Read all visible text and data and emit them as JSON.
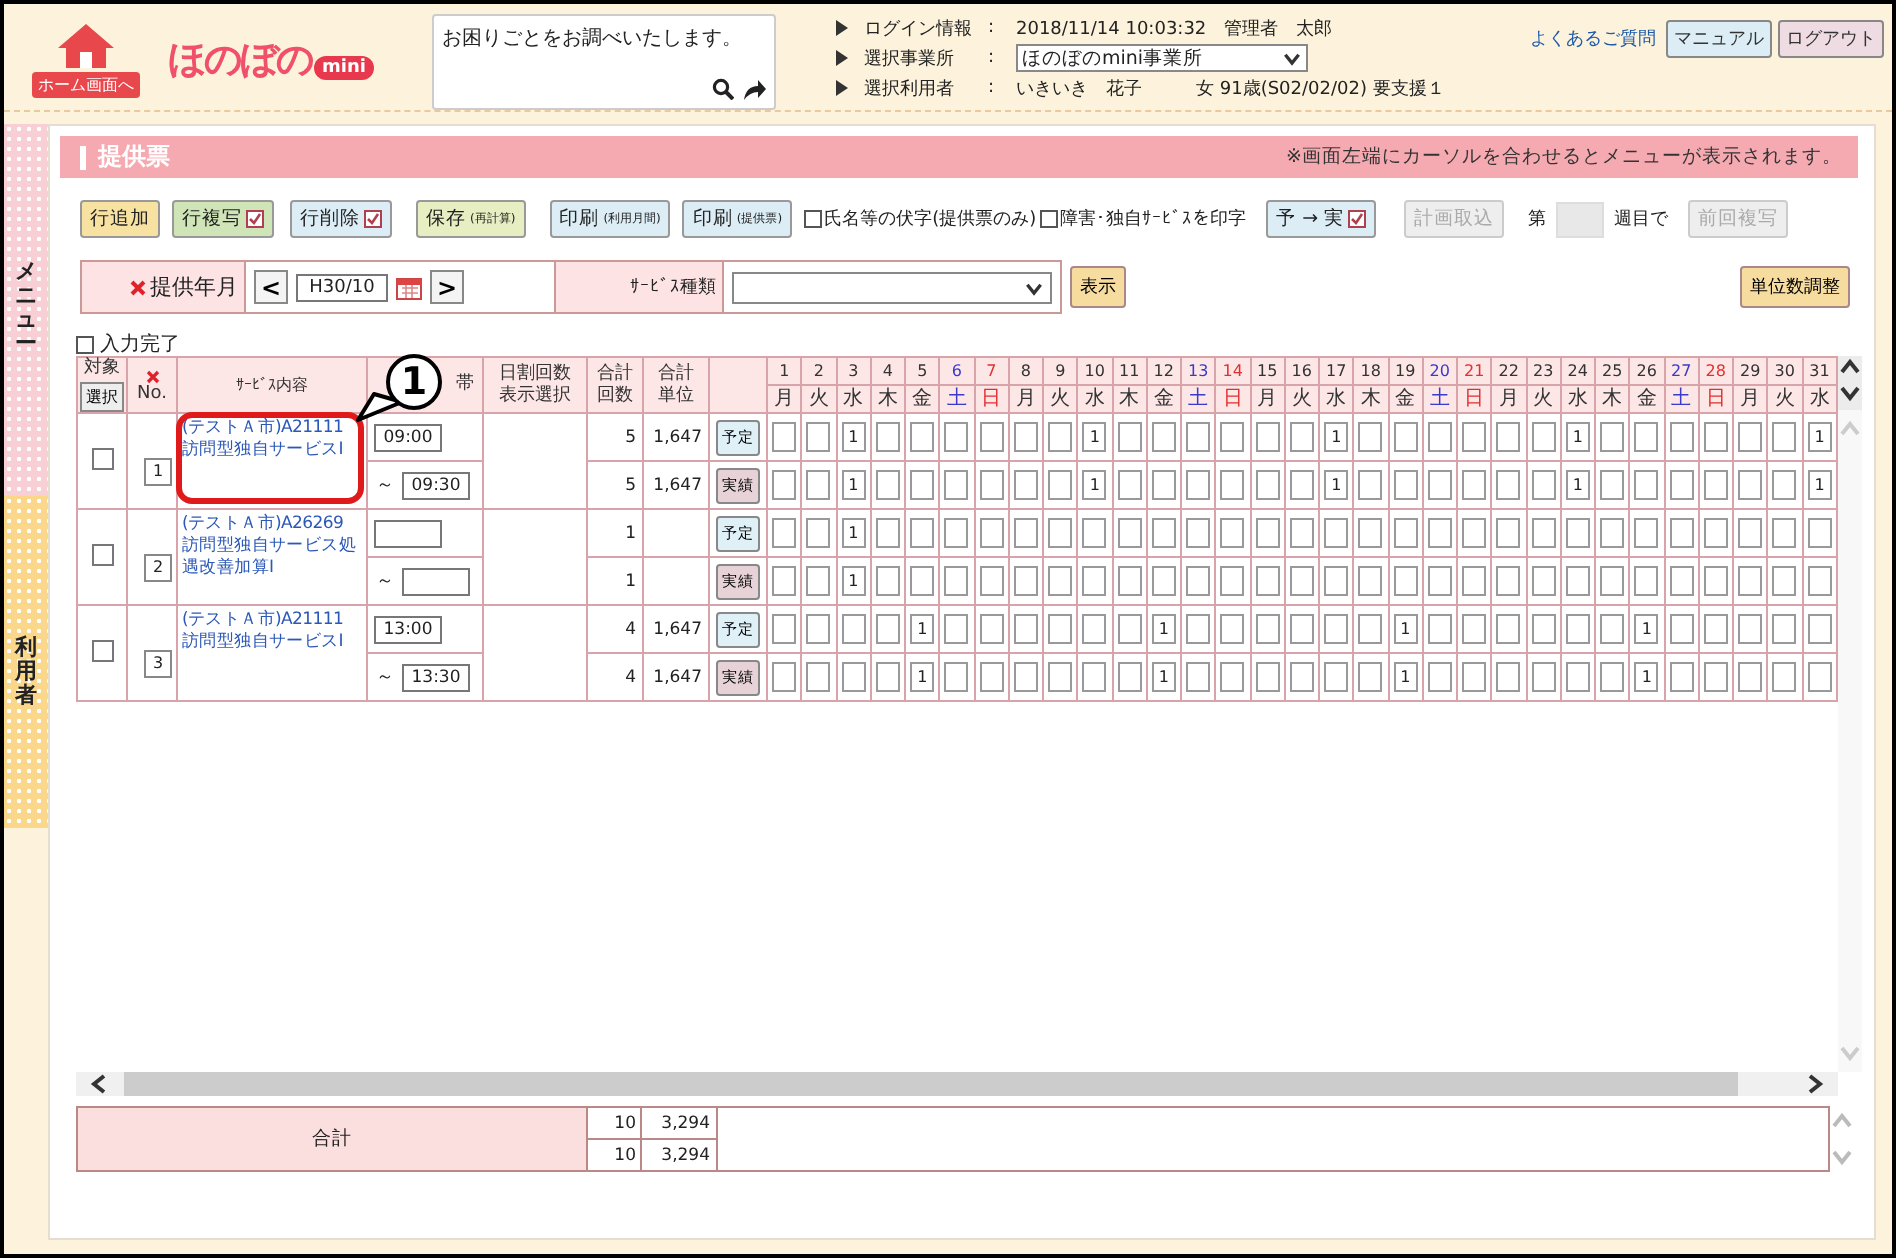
{
  "header": {
    "home": "ホーム画面へ",
    "brand": "ほのぼの",
    "brand_badge": "mini",
    "search": {
      "placeholder": "お困りごとをお調べいたします。"
    },
    "info": [
      {
        "label": "ログイン情報",
        "sep": ":",
        "kind": "text",
        "value": "2018/11/14 10:03:32　管理者　太郎"
      },
      {
        "label": "選択事業所",
        "sep": ":",
        "kind": "select",
        "value": "ほのぼのmini事業所"
      },
      {
        "label": "選択利用者",
        "sep": ":",
        "kind": "text",
        "value": "いきいき　花子　　　女 91歳(S02/02/02) 要支援１"
      }
    ],
    "links": [
      {
        "kind": "link",
        "label": "よくあるご質問"
      },
      {
        "kind": "button",
        "label": "マニュアル",
        "color": "#dcedf6"
      },
      {
        "kind": "button",
        "label": "ログアウト",
        "color": "#efdbe2"
      }
    ]
  },
  "side_tabs": [
    {
      "label": "メニュー",
      "color": "#f7cfd4"
    },
    {
      "label": "利用者",
      "color": "#fbd78c"
    }
  ],
  "page": {
    "title": "提供票",
    "note": "※画面左端にカーソルを合わせるとメニューが表示されます。"
  },
  "toolbar": [
    {
      "kind": "button",
      "label": "行追加",
      "color": "#f7e2a2",
      "check": false,
      "disabled": false
    },
    {
      "kind": "button",
      "label": "行複写",
      "color": "#cfe5b8",
      "check": true,
      "disabled": false
    },
    {
      "kind": "button",
      "label": "行削除",
      "color": "#dcedf6",
      "check": true,
      "disabled": false
    },
    {
      "kind": "button",
      "label": "保存",
      "note": "(再計算)",
      "color": "#e7efc2",
      "check": false,
      "disabled": false
    },
    {
      "kind": "button",
      "label": "印刷",
      "note": "(利用月間)",
      "color": "#dcedf6",
      "check": false,
      "disabled": false
    },
    {
      "kind": "button",
      "label": "印刷",
      "note": "(提供票)",
      "color": "#dcedf6",
      "check": false,
      "disabled": false
    },
    {
      "kind": "checkbox",
      "label": "氏名等の伏字(提供票のみ)",
      "checked": false
    },
    {
      "kind": "checkbox",
      "label": "障害･独自ｻｰﾋﾞｽを印字",
      "checked": false
    },
    {
      "kind": "button",
      "label": "予 → 実",
      "color": "#dcedf6",
      "check": true,
      "disabled": false
    },
    {
      "kind": "button",
      "label": "計画取込",
      "color": "#eeeeee",
      "check": false,
      "disabled": true
    },
    {
      "kind": "week",
      "prefix": "第",
      "suffix": "週目で"
    },
    {
      "kind": "button",
      "label": "前回複写",
      "color": "#eeeeee",
      "check": false,
      "disabled": true
    }
  ],
  "filter": {
    "month_label": "提供年月",
    "prev": "<",
    "month": "H30/10",
    "next": ">",
    "service_type_label": "ｻｰﾋﾞｽ種類",
    "show_button": "表示",
    "adjust_button": "単位数調整"
  },
  "input_complete": {
    "label": "入力完了",
    "checked": false
  },
  "columns": {
    "target": "対象",
    "select_button": "選択",
    "no": "No.",
    "service": "ｻｰﾋﾞｽ内容",
    "time": "帯",
    "daily": "日割回数表示選択",
    "count": "合計回数",
    "units": "合計単位"
  },
  "days": [
    {
      "date": "1",
      "weekday": "月",
      "kind": "day"
    },
    {
      "date": "2",
      "weekday": "火",
      "kind": "day"
    },
    {
      "date": "3",
      "weekday": "水",
      "kind": "day"
    },
    {
      "date": "4",
      "weekday": "木",
      "kind": "day"
    },
    {
      "date": "5",
      "weekday": "金",
      "kind": "day"
    },
    {
      "date": "6",
      "weekday": "土",
      "kind": "sat"
    },
    {
      "date": "7",
      "weekday": "日",
      "kind": "sun"
    },
    {
      "date": "8",
      "weekday": "月",
      "kind": "day"
    },
    {
      "date": "9",
      "weekday": "火",
      "kind": "day"
    },
    {
      "date": "10",
      "weekday": "水",
      "kind": "day"
    },
    {
      "date": "11",
      "weekday": "木",
      "kind": "day"
    },
    {
      "date": "12",
      "weekday": "金",
      "kind": "day"
    },
    {
      "date": "13",
      "weekday": "土",
      "kind": "sat"
    },
    {
      "date": "14",
      "weekday": "日",
      "kind": "sun"
    },
    {
      "date": "15",
      "weekday": "月",
      "kind": "day"
    },
    {
      "date": "16",
      "weekday": "火",
      "kind": "day"
    },
    {
      "date": "17",
      "weekday": "水",
      "kind": "day"
    },
    {
      "date": "18",
      "weekday": "木",
      "kind": "day"
    },
    {
      "date": "19",
      "weekday": "金",
      "kind": "day"
    },
    {
      "date": "20",
      "weekday": "土",
      "kind": "sat"
    },
    {
      "date": "21",
      "weekday": "日",
      "kind": "sun"
    },
    {
      "date": "22",
      "weekday": "月",
      "kind": "day"
    },
    {
      "date": "23",
      "weekday": "火",
      "kind": "day"
    },
    {
      "date": "24",
      "weekday": "水",
      "kind": "day"
    },
    {
      "date": "25",
      "weekday": "木",
      "kind": "day"
    },
    {
      "date": "26",
      "weekday": "金",
      "kind": "day"
    },
    {
      "date": "27",
      "weekday": "土",
      "kind": "sat"
    },
    {
      "date": "28",
      "weekday": "日",
      "kind": "sun"
    },
    {
      "date": "29",
      "weekday": "月",
      "kind": "day"
    },
    {
      "date": "30",
      "weekday": "火",
      "kind": "day"
    },
    {
      "date": "31",
      "weekday": "水",
      "kind": "day"
    }
  ],
  "rows": [
    {
      "no": "1",
      "checked": false,
      "service": "(テストＡ市)A21111 訪問型独自サービスⅠ",
      "highlighted": true,
      "callout": "1",
      "start": "09:00",
      "range_mark": "～",
      "end": "09:30",
      "lines": [
        {
          "kind": "plan",
          "button": "予定",
          "count": "5",
          "units": "1,647",
          "cells": [
            null,
            null,
            "1",
            null,
            null,
            null,
            null,
            null,
            null,
            "1",
            null,
            null,
            null,
            null,
            null,
            null,
            "1",
            null,
            null,
            null,
            null,
            null,
            null,
            "1",
            null,
            null,
            null,
            null,
            null,
            null,
            "1"
          ]
        },
        {
          "kind": "actual",
          "button": "実績",
          "count": "5",
          "units": "1,647",
          "cells": [
            null,
            null,
            "1",
            null,
            null,
            null,
            null,
            null,
            null,
            "1",
            null,
            null,
            null,
            null,
            null,
            null,
            "1",
            null,
            null,
            null,
            null,
            null,
            null,
            "1",
            null,
            null,
            null,
            null,
            null,
            null,
            "1"
          ]
        }
      ]
    },
    {
      "no": "2",
      "checked": false,
      "service": "(テストＡ市)A26269 訪問型独自サービス処遇改善加算Ⅰ",
      "highlighted": false,
      "range_mark": "～",
      "lines": [
        {
          "kind": "plan",
          "button": "予定",
          "count": "1",
          "cells": [
            null,
            null,
            "1",
            null,
            null,
            null,
            null,
            null,
            null,
            null,
            null,
            null,
            null,
            null,
            null,
            null,
            null,
            null,
            null,
            null,
            null,
            null,
            null,
            null,
            null,
            null,
            null,
            null,
            null,
            null,
            null
          ]
        },
        {
          "kind": "actual",
          "button": "実績",
          "count": "1",
          "cells": [
            null,
            null,
            "1",
            null,
            null,
            null,
            null,
            null,
            null,
            null,
            null,
            null,
            null,
            null,
            null,
            null,
            null,
            null,
            null,
            null,
            null,
            null,
            null,
            null,
            null,
            null,
            null,
            null,
            null,
            null,
            null
          ]
        }
      ]
    },
    {
      "no": "3",
      "checked": false,
      "service": "(テストＡ市)A21111 訪問型独自サービスⅠ",
      "highlighted": false,
      "start": "13:00",
      "range_mark": "～",
      "end": "13:30",
      "lines": [
        {
          "kind": "plan",
          "button": "予定",
          "count": "4",
          "units": "1,647",
          "cells": [
            null,
            null,
            null,
            null,
            "1",
            null,
            null,
            null,
            null,
            null,
            null,
            "1",
            null,
            null,
            null,
            null,
            null,
            null,
            "1",
            null,
            null,
            null,
            null,
            null,
            null,
            "1",
            null,
            null,
            null,
            null,
            null
          ]
        },
        {
          "kind": "actual",
          "button": "実績",
          "count": "4",
          "units": "1,647",
          "cells": [
            null,
            null,
            null,
            null,
            "1",
            null,
            null,
            null,
            null,
            null,
            null,
            "1",
            null,
            null,
            null,
            null,
            null,
            null,
            "1",
            null,
            null,
            null,
            null,
            null,
            null,
            "1",
            null,
            null,
            null,
            null,
            null
          ]
        }
      ]
    }
  ],
  "totals": {
    "label": "合計",
    "lines": [
      {
        "count": "10",
        "units": "3,294"
      },
      {
        "count": "10",
        "units": "3,294"
      }
    ]
  }
}
